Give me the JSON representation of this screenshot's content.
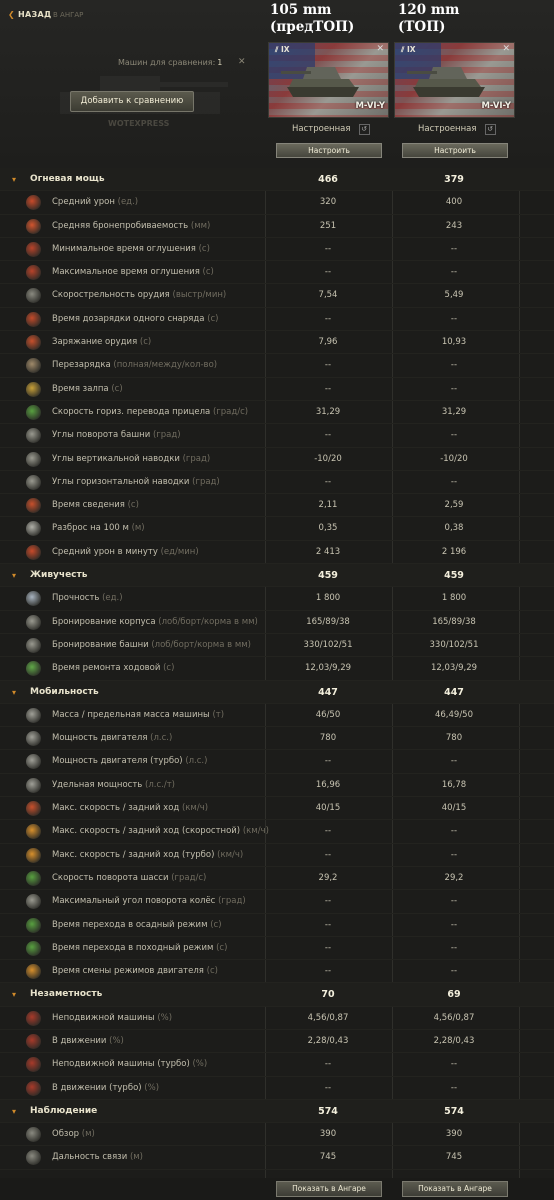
{
  "header": {
    "back_label": "НАЗАД",
    "to_hangar_label": "В АНГАР",
    "compare_count_label": "Машин для сравнения:",
    "compare_count": "1",
    "add_button": "Добавить к сравнению",
    "watermark": "WOTEXPRESS"
  },
  "columns": [
    {
      "title_line1": "105 mm",
      "title_line2": "(предТОП)",
      "tier": "IX",
      "tank_name": "M-VI-Y",
      "status": "Настроенная",
      "configure_button": "Настроить",
      "show_button": "Показать в Ангаре"
    },
    {
      "title_line1": "120 mm",
      "title_line2": "(ТОП)",
      "tier": "IX",
      "tank_name": "M-VI-Y",
      "status": "Настроенная",
      "configure_button": "Настроить",
      "show_button": "Показать в Ангаре"
    }
  ],
  "rows": [
    {
      "type": "section",
      "label": "Огневая мощь",
      "v1": "466",
      "v2": "379"
    },
    {
      "label": "Средний урон",
      "unit": "(ед.)",
      "icon": "damage-icon",
      "color": "#c94a2a",
      "v1": "320",
      "v2": "400"
    },
    {
      "label": "Средняя бронепробиваемость",
      "unit": "(мм)",
      "icon": "penetration-icon",
      "color": "#d2552e",
      "v1": "251",
      "v2": "243"
    },
    {
      "label": "Минимальное время оглушения",
      "unit": "(с)",
      "icon": "stun-min-icon",
      "color": "#b8432a",
      "v1": "--",
      "v2": "--"
    },
    {
      "label": "Максимальное время оглушения",
      "unit": "(с)",
      "icon": "stun-max-icon",
      "color": "#b8432a",
      "v1": "--",
      "v2": "--"
    },
    {
      "label": "Скорострельность орудия",
      "unit": "(выстр/мин)",
      "icon": "rate-of-fire-icon",
      "color": "#8a8a80",
      "v1": "7,54",
      "v2": "5,49"
    },
    {
      "label": "Время дозарядки одного снаряда",
      "unit": "(с)",
      "icon": "shell-reload-icon",
      "color": "#c24a2a",
      "v1": "--",
      "v2": "--"
    },
    {
      "label": "Заряжание орудия",
      "unit": "(с)",
      "icon": "reload-icon",
      "color": "#c8502c",
      "v1": "7,96",
      "v2": "10,93"
    },
    {
      "label": "Перезарядка",
      "unit": "(полная/между/кол-во)",
      "icon": "autoloader-icon",
      "color": "#a08a6a",
      "v1": "--",
      "v2": "--"
    },
    {
      "label": "Время залпа",
      "unit": "(с)",
      "icon": "salvo-icon",
      "color": "#c8a038",
      "v1": "--",
      "v2": "--"
    },
    {
      "label": "Скорость гориз. перевода прицела",
      "unit": "(град/с)",
      "icon": "traverse-aim-icon",
      "color": "#58a040",
      "v1": "31,29",
      "v2": "31,29"
    },
    {
      "label": "Углы поворота башни",
      "unit": "(град)",
      "icon": "turret-angle-icon",
      "color": "#9a9a90",
      "v1": "--",
      "v2": "--"
    },
    {
      "label": "Углы вертикальной наводки",
      "unit": "(град)",
      "icon": "elevation-icon",
      "color": "#9a9a90",
      "v1": "-10/20",
      "v2": "-10/20"
    },
    {
      "label": "Углы горизонтальной наводки",
      "unit": "(град)",
      "icon": "horizontal-angle-icon",
      "color": "#9a9a90",
      "v1": "--",
      "v2": "--"
    },
    {
      "label": "Время сведения",
      "unit": "(с)",
      "icon": "aim-time-icon",
      "color": "#c8502c",
      "v1": "2,11",
      "v2": "2,59"
    },
    {
      "label": "Разброс на 100 м",
      "unit": "(м)",
      "icon": "dispersion-icon",
      "color": "#b0b0a8",
      "v1": "0,35",
      "v2": "0,38"
    },
    {
      "label": "Средний урон в минуту",
      "unit": "(ед/мин)",
      "icon": "dpm-icon",
      "color": "#c94a2a",
      "v1": "2 413",
      "v2": "2 196"
    },
    {
      "type": "section",
      "label": "Живучесть",
      "v1": "459",
      "v2": "459"
    },
    {
      "label": "Прочность",
      "unit": "(ед.)",
      "icon": "hitpoints-icon",
      "color": "#a8b4c0",
      "v1": "1 800",
      "v2": "1 800"
    },
    {
      "label": "Бронирование корпуса",
      "unit": "(лоб/борт/корма в мм)",
      "icon": "hull-armor-icon",
      "color": "#9a9a90",
      "v1": "165/89/38",
      "v2": "165/89/38"
    },
    {
      "label": "Бронирование башни",
      "unit": "(лоб/борт/корма в мм)",
      "icon": "turret-armor-icon",
      "color": "#9a9a90",
      "v1": "330/102/51",
      "v2": "330/102/51"
    },
    {
      "label": "Время ремонта ходовой",
      "unit": "(с)",
      "icon": "repair-icon",
      "color": "#60a848",
      "v1": "12,03/9,29",
      "v2": "12,03/9,29"
    },
    {
      "type": "section",
      "label": "Мобильность",
      "v1": "447",
      "v2": "447"
    },
    {
      "label": "Масса / предельная масса машины",
      "unit": "(т)",
      "icon": "weight-icon",
      "color": "#a0a098",
      "v1": "46/50",
      "v2": "46,49/50"
    },
    {
      "label": "Мощность двигателя",
      "unit": "(л.с.)",
      "icon": "engine-icon",
      "color": "#a0a098",
      "v1": "780",
      "v2": "780"
    },
    {
      "label": "Мощность двигателя (турбо)",
      "unit": "(л.с.)",
      "icon": "engine-turbo-icon",
      "color": "#a0a098",
      "v1": "--",
      "v2": "--"
    },
    {
      "label": "Удельная мощность",
      "unit": "(л.с./т)",
      "icon": "power-ratio-icon",
      "color": "#a0a098",
      "v1": "16,96",
      "v2": "16,78"
    },
    {
      "label": "Макс. скорость / задний ход",
      "unit": "(км/ч)",
      "icon": "speed-icon",
      "color": "#c8502c",
      "v1": "40/15",
      "v2": "40/15"
    },
    {
      "label": "Макс. скорость / задний ход (скоростной)",
      "unit": "(км/ч)",
      "icon": "speed-mode-icon",
      "color": "#d8902c",
      "v1": "--",
      "v2": "--"
    },
    {
      "label": "Макс. скорость / задний ход (турбо)",
      "unit": "(км/ч)",
      "icon": "speed-turbo-icon",
      "color": "#d8902c",
      "v1": "--",
      "v2": "--"
    },
    {
      "label": "Скорость поворота шасси",
      "unit": "(град/с)",
      "icon": "hull-traverse-icon",
      "color": "#58a040",
      "v1": "29,2",
      "v2": "29,2"
    },
    {
      "label": "Максимальный угол поворота колёс",
      "unit": "(град)",
      "icon": "wheel-angle-icon",
      "color": "#9a9a90",
      "v1": "--",
      "v2": "--"
    },
    {
      "label": "Время перехода в осадный режим",
      "unit": "(с)",
      "icon": "siege-mode-icon",
      "color": "#58a040",
      "v1": "--",
      "v2": "--"
    },
    {
      "label": "Время перехода в походный режим",
      "unit": "(с)",
      "icon": "travel-mode-icon",
      "color": "#58a040",
      "v1": "--",
      "v2": "--"
    },
    {
      "label": "Время смены режимов двигателя",
      "unit": "(с)",
      "icon": "engine-mode-icon",
      "color": "#d8902c",
      "v1": "--",
      "v2": "--"
    },
    {
      "type": "section",
      "label": "Незаметность",
      "v1": "70",
      "v2": "69"
    },
    {
      "label": "Неподвижной машины",
      "unit": "(%)",
      "icon": "camo-stationary-icon",
      "color": "#a83a2a",
      "v1": "4,56/0,87",
      "v2": "4,56/0,87"
    },
    {
      "label": "В движении",
      "unit": "(%)",
      "icon": "camo-moving-icon",
      "color": "#a83a2a",
      "v1": "2,28/0,43",
      "v2": "2,28/0,43"
    },
    {
      "label": "Неподвижной машины (турбо)",
      "unit": "(%)",
      "icon": "camo-stationary-turbo-icon",
      "color": "#a83a2a",
      "v1": "--",
      "v2": "--"
    },
    {
      "label": "В движении (турбо)",
      "unit": "(%)",
      "icon": "camo-moving-turbo-icon",
      "color": "#a83a2a",
      "v1": "--",
      "v2": "--"
    },
    {
      "type": "section",
      "label": "Наблюдение",
      "v1": "574",
      "v2": "574"
    },
    {
      "label": "Обзор",
      "unit": "(м)",
      "icon": "view-range-icon",
      "color": "#8a8a80",
      "v1": "390",
      "v2": "390"
    },
    {
      "label": "Дальность связи",
      "unit": "(м)",
      "icon": "radio-range-icon",
      "color": "#8a8a80",
      "v1": "745",
      "v2": "745"
    }
  ]
}
